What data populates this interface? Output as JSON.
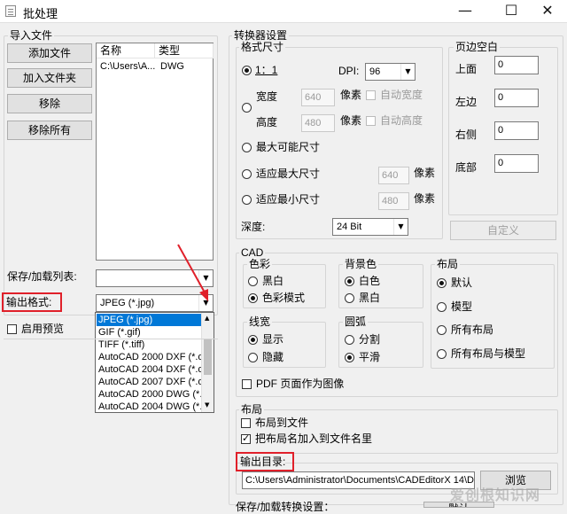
{
  "window": {
    "title": "批处理",
    "minimize_icon": "—",
    "maximize_icon": "☐",
    "close_icon": "✕"
  },
  "import": {
    "title": "导入文件",
    "buttons": {
      "add_file": "添加文件",
      "add_folder": "加入文件夹",
      "remove": "移除",
      "remove_all": "移除所有"
    },
    "columns": [
      "名称",
      "类型"
    ],
    "rows": [
      {
        "name": "C:\\Users\\A...",
        "type": "DWG"
      }
    ]
  },
  "save_load_label": "保存/加载列表:",
  "output_format": {
    "label": "输出格式:",
    "selected": "JPEG (*.jpg)",
    "options": [
      "JPEG (*.jpg)",
      "GIF (*.gif)",
      "TIFF (*.tiff)",
      "AutoCAD 2000 DXF (*.dx",
      "AutoCAD 2004 DXF (*.dx",
      "AutoCAD 2007 DXF (*.dx",
      "AutoCAD 2000 DWG (*.c",
      "AutoCAD 2004 DWG (*.c"
    ]
  },
  "enable_preview": "启用预览",
  "converter": {
    "title": "转换器设置",
    "format_size": {
      "title": "格式尺寸",
      "one_to_one": "1：1",
      "dpi_label": "DPI:",
      "dpi_value": "96",
      "width_label": "宽度",
      "width_value": "640",
      "height_label": "高度",
      "height_value": "480",
      "pixel": "像素",
      "auto_width": "自动宽度",
      "auto_height": "自动高度",
      "max_possible": "最大可能尺寸",
      "fit_max": "适应最大尺寸",
      "fit_max_value": "640",
      "fit_min": "适应最小尺寸",
      "fit_min_value": "480",
      "depth_label": "深度:",
      "depth_value": "24 Bit"
    },
    "margins": {
      "title": "页边空白",
      "top_label": "上面",
      "top": "0",
      "left_label": "左边",
      "left": "0",
      "right_label": "右侧",
      "right": "0",
      "bottom_label": "底部",
      "bottom": "0",
      "custom_button": "自定义"
    },
    "cad": {
      "title": "CAD",
      "color": {
        "title": "色彩",
        "options": [
          "黑白",
          "色彩模式"
        ],
        "selected": 1
      },
      "background": {
        "title": "背景色",
        "options": [
          "白色",
          "黑白"
        ],
        "selected": 0
      },
      "layout": {
        "title": "布局",
        "options": [
          "默认",
          "模型",
          "所有布局",
          "所有布局与模型"
        ],
        "selected": 0
      },
      "lineweight": {
        "title": "线宽",
        "options": [
          "显示",
          "隐藏"
        ],
        "selected": 0
      },
      "arc": {
        "title": "圆弧",
        "options": [
          "分割",
          "平滑"
        ],
        "selected": 1
      },
      "pdf_as_image": "PDF 页面作为图像"
    },
    "layout_group": {
      "title": "布局",
      "layout_to_file": "布局到文件",
      "add_layout_name": "把布局名加入到文件名里"
    },
    "output_dir": {
      "label": "输出目录:",
      "path": "C:\\Users\\Administrator\\Documents\\CADEditorX 14\\D",
      "browse": "浏览"
    },
    "bottom_label": "保存/加载转换设置：",
    "bottom_button": "默认"
  },
  "watermark": "爱创根知识网",
  "accent": "#0078d7",
  "highlight": "#e0202a"
}
